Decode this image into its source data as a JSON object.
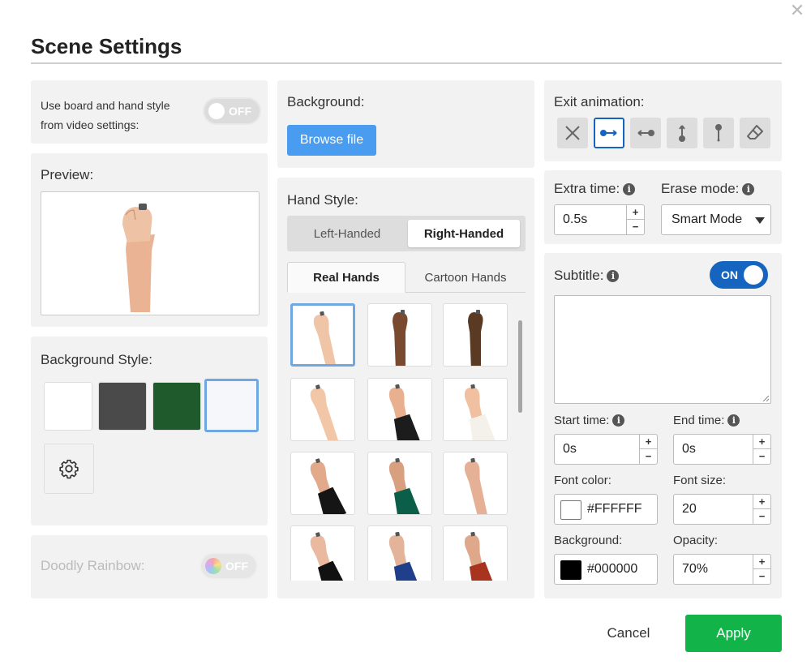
{
  "dialog": {
    "title": "Scene Settings"
  },
  "left": {
    "use_board_line1": "Use board and hand style",
    "use_board_line2": "from video settings:",
    "use_board_toggle": "OFF",
    "preview_label": "Preview:",
    "bg_style_label": "Background Style:",
    "swatches": [
      {
        "name": "white",
        "color": "#FFFFFF"
      },
      {
        "name": "dark-gray",
        "color": "#4a4a4a"
      },
      {
        "name": "green",
        "color": "#1e5a2c"
      },
      {
        "name": "light-white",
        "color": "#f5f7fa"
      }
    ],
    "rainbow_label": "Doodly Rainbow:",
    "rainbow_toggle": "OFF"
  },
  "middle": {
    "background_label": "Background:",
    "browse_button": "Browse file",
    "hand_style_label": "Hand Style:",
    "left_handed": "Left-Handed",
    "right_handed": "Right-Handed",
    "tab_real": "Real Hands",
    "tab_cartoon": "Cartoon Hands",
    "hands": [
      {
        "skin": "#f0c4a6",
        "sleeve": null
      },
      {
        "skin": "#7a4a30",
        "sleeve": null
      },
      {
        "skin": "#5b3a24",
        "sleeve": null
      },
      {
        "skin": "#f1c7a8",
        "sleeve": null
      },
      {
        "skin": "#e8b08e",
        "sleeve": "#1c1c1c"
      },
      {
        "skin": "#f0c0a0",
        "sleeve": "#f4f1ea"
      },
      {
        "skin": "#e2a98a",
        "sleeve": "#151515"
      },
      {
        "skin": "#d9a080",
        "sleeve": "#0b5e48"
      },
      {
        "skin": "#e6b096",
        "sleeve": null
      },
      {
        "skin": "#e9b9a0",
        "sleeve": "#111111"
      },
      {
        "skin": "#e3b49a",
        "sleeve": "#1f3f8a"
      },
      {
        "skin": "#e0a88a",
        "sleeve": "#a8331e"
      }
    ]
  },
  "right": {
    "exit_label": "Exit animation:",
    "exit_icons": [
      "none-icon",
      "move-left-icon",
      "move-right-icon",
      "move-down-icon",
      "move-up-icon",
      "eraser-icon"
    ],
    "extra_time_label": "Extra time:",
    "extra_time_value": "0.5s",
    "erase_mode_label": "Erase mode:",
    "erase_mode_value": "Smart Mode",
    "subtitle_label": "Subtitle:",
    "subtitle_toggle": "ON",
    "start_time_label": "Start time:",
    "start_time_value": "0s",
    "end_time_label": "End time:",
    "end_time_value": "0s",
    "font_color_label": "Font color:",
    "font_color_value": "#FFFFFF",
    "font_size_label": "Font size:",
    "font_size_value": "20",
    "background_label": "Background:",
    "background_value": "#000000",
    "opacity_label": "Opacity:",
    "opacity_value": "70%"
  },
  "footer": {
    "cancel": "Cancel",
    "apply": "Apply"
  },
  "icons": {
    "info": "i",
    "close": "✕",
    "plus": "+",
    "minus": "−"
  }
}
